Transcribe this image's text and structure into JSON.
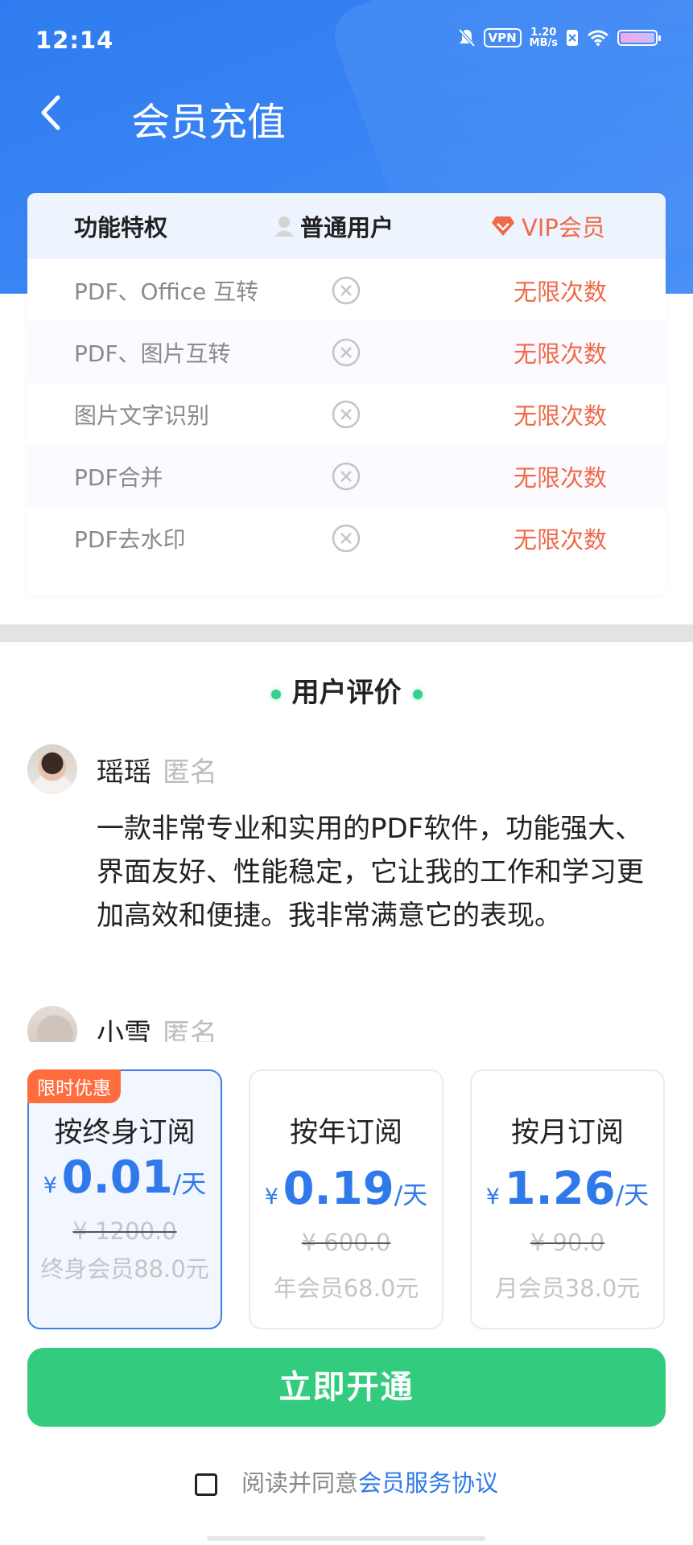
{
  "status_bar": {
    "time": "12:14",
    "vpn": "VPN",
    "speed_value": "1.20",
    "speed_unit": "MB/s"
  },
  "header": {
    "title": "会员充值"
  },
  "comparison": {
    "col_feature": "功能特权",
    "col_normal": "普通用户",
    "col_vip": "VIP会员",
    "rows": [
      {
        "feature": "PDF、Office 互转",
        "normal": "×",
        "vip": "无限次数"
      },
      {
        "feature": "PDF、图片互转",
        "normal": "×",
        "vip": "无限次数"
      },
      {
        "feature": "图片文字识别",
        "normal": "×",
        "vip": "无限次数"
      },
      {
        "feature": "PDF合并",
        "normal": "×",
        "vip": "无限次数"
      },
      {
        "feature": "PDF去水印",
        "normal": "×",
        "vip": "无限次数"
      }
    ]
  },
  "reviews": {
    "title": "用户评价",
    "items": [
      {
        "name": "瑶瑶",
        "tag": "匿名",
        "text": "一款非常专业和实用的PDF软件，功能强大、界面友好、性能稳定，它让我的工作和学习更加高效和便捷。我非常满意它的表现。"
      },
      {
        "name": "小雪",
        "tag": "匿名"
      }
    ]
  },
  "plans": [
    {
      "badge": "限时优惠",
      "name": "按终身订阅",
      "currency": "¥",
      "price": "0.01",
      "unit": "/天",
      "original": "¥ 1200.0",
      "desc": "终身会员88.0元",
      "selected": true
    },
    {
      "name": "按年订阅",
      "currency": "¥",
      "price": "0.19",
      "unit": "/天",
      "original": "¥ 600.0",
      "desc": "年会员68.0元",
      "selected": false
    },
    {
      "name": "按月订阅",
      "currency": "¥",
      "price": "1.26",
      "unit": "/天",
      "original": "¥ 90.0",
      "desc": "月会员38.0元",
      "selected": false
    }
  ],
  "cta": {
    "label": "立即开通"
  },
  "agreement": {
    "prefix": "阅读并同意",
    "link": "会员服务协议",
    "checked": false
  },
  "colors": {
    "header_blue": "#3b86f5",
    "vip_orange": "#ee6b4a",
    "price_blue": "#2f79ea",
    "cta_green": "#33cc7e",
    "badge_orange": "#ff6d3f"
  }
}
